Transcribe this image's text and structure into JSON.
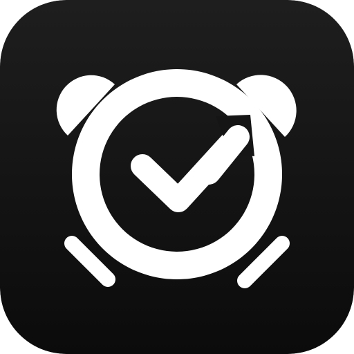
{
  "app_icon": {
    "name": "alarm-clock-checkmark",
    "glyph": "alarm-clock-icon",
    "badge": "checkmark-icon",
    "colors": {
      "background_top": "#1e1e1e",
      "background_bottom": "#0b0b0b",
      "glyph": "#ffffff"
    }
  }
}
